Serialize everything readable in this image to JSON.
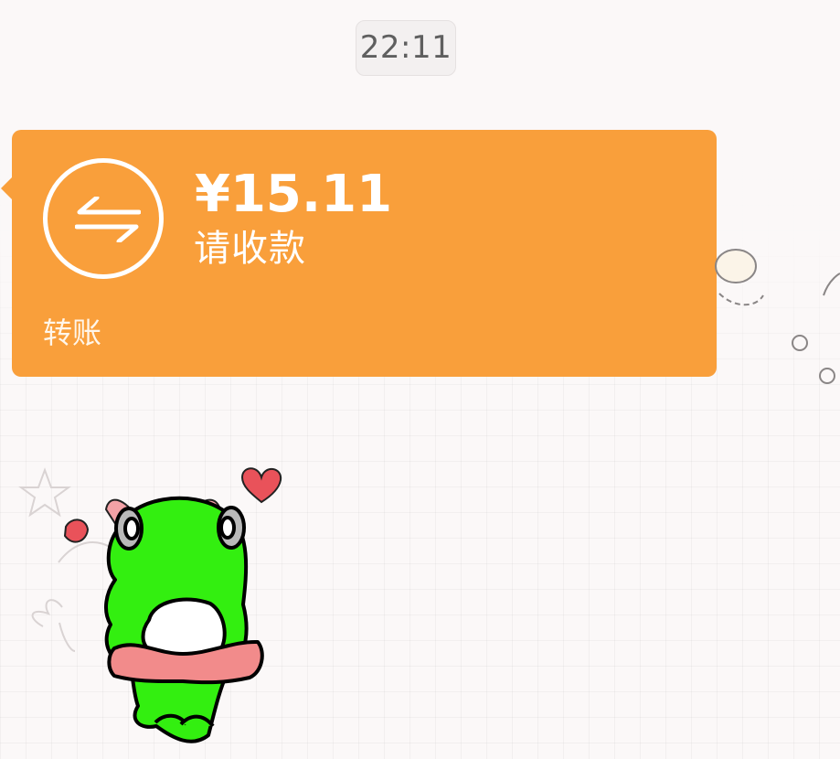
{
  "chat": {
    "timestamp": "22:11"
  },
  "transfer": {
    "amount": "¥15.11",
    "status": "请收款",
    "footer_label": "转账",
    "icon": "transfer-arrows-icon",
    "card_color": "#f99f3b"
  },
  "sticker": {
    "icon": "green-frog-sticker"
  }
}
